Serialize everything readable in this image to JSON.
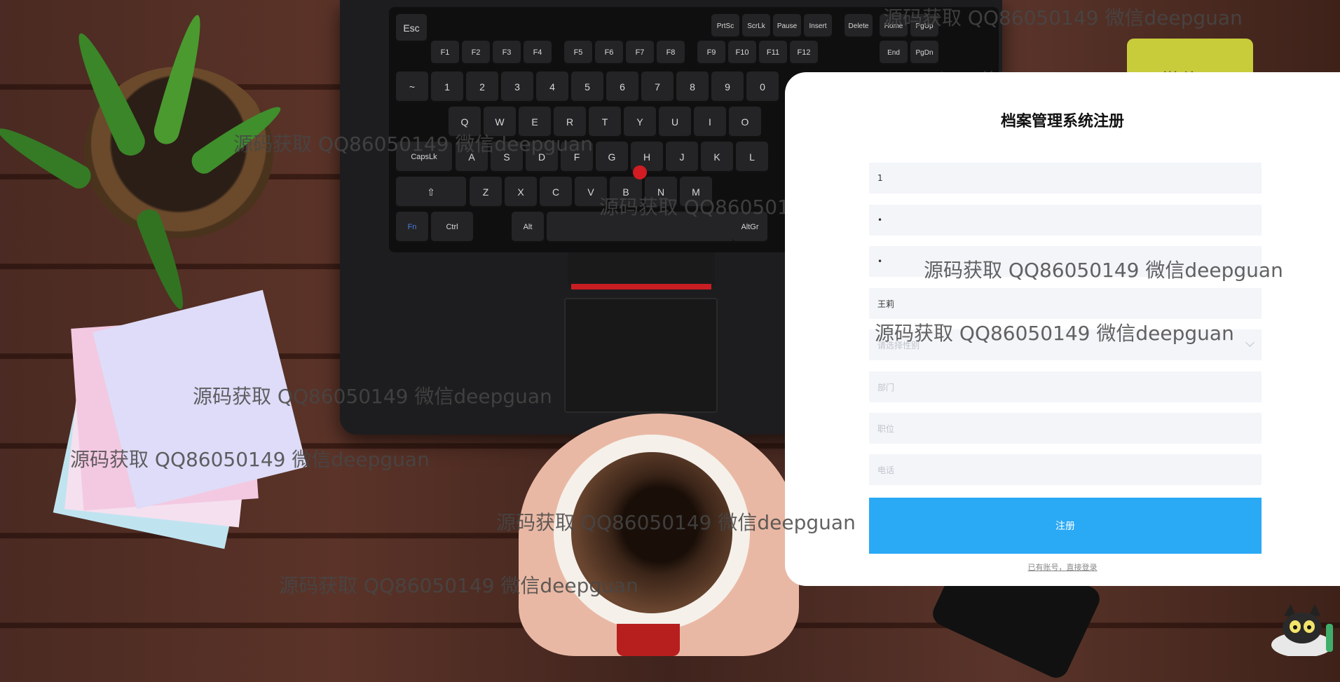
{
  "window": {
    "title": "档案管理系统注册"
  },
  "form": {
    "title": "档案管理系统注册",
    "fields": [
      {
        "name": "username",
        "value": "1",
        "placeholder": ""
      },
      {
        "name": "password",
        "value": "•",
        "placeholder": ""
      },
      {
        "name": "confirm_password",
        "value": "•",
        "placeholder": ""
      },
      {
        "name": "real_name",
        "value": "王莉",
        "placeholder": ""
      },
      {
        "name": "gender",
        "value": "",
        "placeholder": "请选择性别"
      },
      {
        "name": "department",
        "value": "",
        "placeholder": "部门"
      },
      {
        "name": "position",
        "value": "",
        "placeholder": "职位"
      },
      {
        "name": "phone",
        "value": "",
        "placeholder": "电话"
      }
    ],
    "submit_label": "注册",
    "login_link": "已有账号，直接登录"
  },
  "watermarks": [
    "源码获取 QQ86050149 微信deepguan",
    "源码获取 QQ86050149 微信deepguan",
    "源码获取 QQ86050149 微信deepguan",
    "源码获取 QQ86050149 微信deepguan",
    "源码获取 QQ86050149 微信deepguan",
    "源码获取 QQ86050149 微信deepguan",
    "源码获取 QQ86050149 微信deepguan",
    "源码获取 QQ86050149 微信deepguan",
    "源码获取 QQ86050149 微信deepguan",
    "源码获取 QQ86050149 微信deepguan"
  ],
  "keyboard": {
    "row_fn": [
      "Esc",
      "F1",
      "F2",
      "F3",
      "F4",
      "F5",
      "F6",
      "F7",
      "F8",
      "F9",
      "F10",
      "F11",
      "F12",
      "PrtSc",
      "ScrLk",
      "Pause",
      "Insert",
      "Delete",
      "Home",
      "End",
      "PgUp",
      "PgDn"
    ],
    "row_num": [
      "~",
      "1",
      "2",
      "3",
      "4",
      "5",
      "6",
      "7",
      "8",
      "9",
      "0"
    ],
    "row_q": [
      "Q",
      "W",
      "E",
      "R",
      "T",
      "Y",
      "U",
      "I",
      "O"
    ],
    "row_a": [
      "CapsLk",
      "A",
      "S",
      "D",
      "F",
      "G",
      "H",
      "J",
      "K",
      "L"
    ],
    "row_z": [
      "Z",
      "X",
      "C",
      "V",
      "B",
      "N",
      "M"
    ],
    "row_mod": [
      "Fn",
      "Ctrl",
      "Alt",
      "AltGr"
    ]
  },
  "colors": {
    "accent": "#2aa9f5",
    "panel_bg": "#ffffff",
    "field_bg": "#f3f5f9",
    "placeholder": "#c0c4cc"
  }
}
